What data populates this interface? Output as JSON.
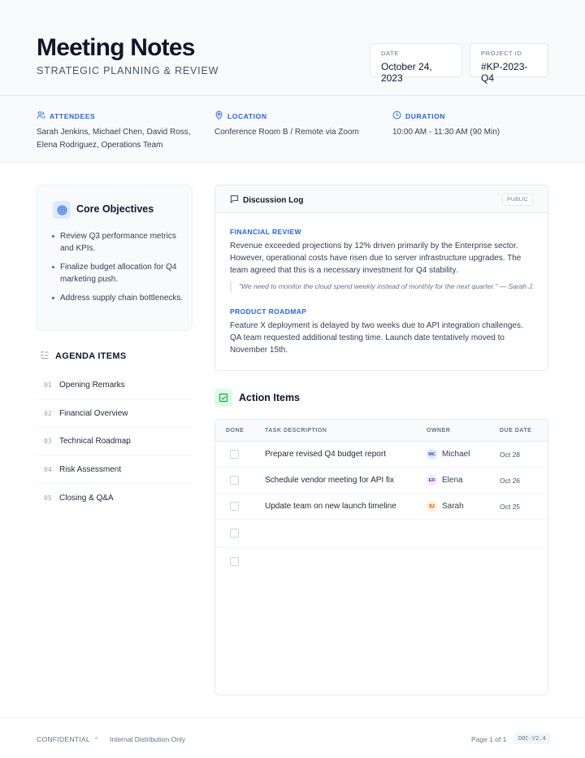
{
  "header": {
    "title": "Meeting Notes",
    "subtitle": "STRATEGIC PLANNING & REVIEW",
    "date_label": "DATE",
    "date_value": "October 24, 2023",
    "project_label": "PROJECT ID",
    "project_value": "#KP-2023-Q4"
  },
  "info": {
    "attendees_label": "ATTENDEES",
    "attendees_line1": "Sarah Jenkins, Michael Chen, David Ross,",
    "attendees_line2": "Elena Rodriguez, Operations Team",
    "location_label": "LOCATION",
    "location_value": "Conference Room B / Remote via Zoom",
    "duration_label": "DURATION",
    "duration_value": "10:00 AM - 11:30 AM (90 Min)"
  },
  "objectives": {
    "title": "Core Objectives",
    "items": [
      "Review Q3 performance metrics and KPIs.",
      "Finalize budget allocation for Q4 marketing push.",
      "Address supply chain bottlenecks."
    ]
  },
  "agenda": {
    "title": "AGENDA ITEMS",
    "items": [
      {
        "num": "01",
        "label": "Opening Remarks"
      },
      {
        "num": "02",
        "label": "Financial Overview"
      },
      {
        "num": "03",
        "label": "Technical Roadmap"
      },
      {
        "num": "04",
        "label": "Risk Assessment"
      },
      {
        "num": "05",
        "label": "Closing & Q&A"
      }
    ]
  },
  "discussion": {
    "title": "Discussion Log",
    "badge": "PUBLIC",
    "financial_title": "FINANCIAL REVIEW",
    "financial_body": "Revenue exceeded projections by 12% driven primarily by the Enterprise sector. However, operational costs have risen due to server infrastructure upgrades. The team agreed that this is a necessary investment for Q4 stability.",
    "quote": "\"We need to monitor the cloud spend weekly instead of monthly for the next quarter.\" — Sarah J.",
    "roadmap_title": "PRODUCT ROADMAP",
    "roadmap_body": "Feature X deployment is delayed by two weeks due to API integration challenges. QA team requested additional testing time. Launch date tentatively moved to November 15th."
  },
  "actions": {
    "title": "Action Items",
    "columns": {
      "done": "DONE",
      "task": "TASK DESCRIPTION",
      "owner": "OWNER",
      "due": "DUE DATE"
    },
    "rows": [
      {
        "task": "Prepare revised Q4 budget report",
        "initials": "MC",
        "owner": "Michael",
        "due": "Oct 28",
        "bg": "#dbeafe",
        "fg": "#1d4ed8"
      },
      {
        "task": "Schedule vendor meeting for API fix",
        "initials": "ER",
        "owner": "Elena",
        "due": "Oct 26",
        "bg": "#f3e8ff",
        "fg": "#7e22ce"
      },
      {
        "task": "Update team on new launch timeline",
        "initials": "SJ",
        "owner": "Sarah",
        "due": "Oct 25",
        "bg": "#ffedd5",
        "fg": "#c2410c"
      }
    ]
  },
  "footer": {
    "confidential": "CONFIDENTIAL",
    "bullet": "•",
    "distribution": "Internal Distribution Only",
    "page": "Page 1 of 1",
    "version": "DOC-V2.4"
  },
  "colors": {
    "accent": "#2563eb",
    "success": "#16a34a"
  }
}
